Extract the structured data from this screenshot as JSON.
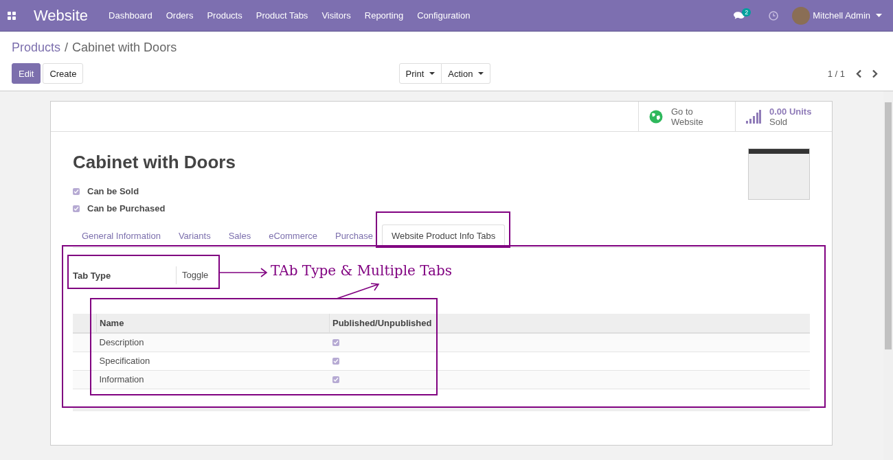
{
  "navbar": {
    "app_name": "Website",
    "menu": [
      "Dashboard",
      "Orders",
      "Products",
      "Product Tabs",
      "Visitors",
      "Reporting",
      "Configuration"
    ],
    "messages_badge": "2",
    "user": "Mitchell Admin"
  },
  "breadcrumb": {
    "parent": "Products",
    "separator": "/",
    "current": "Cabinet with Doors"
  },
  "buttons": {
    "edit": "Edit",
    "create": "Create",
    "print": "Print",
    "action": "Action"
  },
  "pager": "1 / 1",
  "smart_buttons": [
    {
      "kind": "website",
      "line1": "Go to",
      "line2": "Website"
    },
    {
      "kind": "sales",
      "line1": "0.00 Units",
      "line2": "Sold"
    }
  ],
  "product": {
    "name": "Cabinet with Doors",
    "options": [
      {
        "label": "Can be Sold",
        "checked": true
      },
      {
        "label": "Can be Purchased",
        "checked": true
      }
    ]
  },
  "tabs": [
    {
      "label": "General Information",
      "selected": false
    },
    {
      "label": "Variants",
      "selected": false
    },
    {
      "label": "Sales",
      "selected": false
    },
    {
      "label": "eCommerce",
      "selected": false
    },
    {
      "label": "Purchase",
      "selected": false
    },
    {
      "label": "Website Product Info Tabs",
      "selected": true
    }
  ],
  "tab_type": {
    "label": "Tab Type",
    "value": "Toggle"
  },
  "table": {
    "columns": [
      "Name",
      "Published/Unpublished"
    ],
    "rows": [
      {
        "name": "Description",
        "published": true
      },
      {
        "name": "Specification",
        "published": true
      },
      {
        "name": "Information",
        "published": true
      }
    ]
  },
  "annotation": "TAb Type & Multiple Tabs"
}
